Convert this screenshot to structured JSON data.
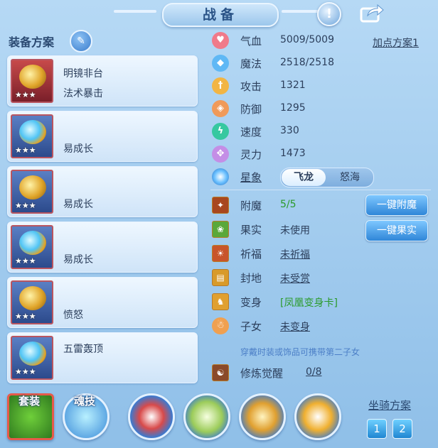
{
  "window": {
    "title": "战备",
    "info_icon": "!"
  },
  "left": {
    "header": "装备方案",
    "cards": [
      {
        "l1": "明镜非台",
        "l2": "法术暴击",
        "stars": "★★★"
      },
      {
        "l1": "",
        "l2": "易成长",
        "stars": "★★★"
      },
      {
        "l1": "",
        "l2": "易成长",
        "stars": "★★★"
      },
      {
        "l1": "",
        "l2": "易成长",
        "stars": "★★★"
      },
      {
        "l1": "",
        "l2": "愤怒",
        "stars": "★★★"
      },
      {
        "l1": "五雷轰顶",
        "l2": "",
        "stars": "★★★"
      }
    ]
  },
  "stats": {
    "hp": {
      "label": "气血",
      "value": "5009/5009"
    },
    "mp": {
      "label": "魔法",
      "value": "2518/2518"
    },
    "atk": {
      "label": "攻击",
      "value": "1321"
    },
    "def": {
      "label": "防御",
      "value": "1295"
    },
    "spd": {
      "label": "速度",
      "value": "330"
    },
    "spi": {
      "label": "灵力",
      "value": "1473"
    },
    "plan_link": "加点方案1"
  },
  "xingxiang": {
    "label": "星象",
    "opt1": "飞龙",
    "opt2": "怒海"
  },
  "extras": {
    "fumo": {
      "label": "附魔",
      "value": "5/5"
    },
    "guoshi": {
      "label": "果实",
      "value": "未使用"
    },
    "qifu": {
      "label": "祈福",
      "value": "未祈福"
    },
    "fengdi": {
      "label": "封地",
      "value": "未受赏"
    },
    "bianshen": {
      "label": "变身",
      "value": "[凤凰变身卡]"
    },
    "zinv": {
      "label": "子女",
      "value": "未变身"
    },
    "hint": "穿戴时装或饰品可携带第二子女",
    "xiulian": {
      "label": "修炼觉醒",
      "value": "0/8"
    },
    "btn_fumo": "一键附魔",
    "btn_guoshi": "一键果实"
  },
  "bottom": {
    "tao": "套装",
    "hun": "魂技",
    "mount_label": "坐骑方案",
    "mount1": "1",
    "mount2": "2"
  }
}
